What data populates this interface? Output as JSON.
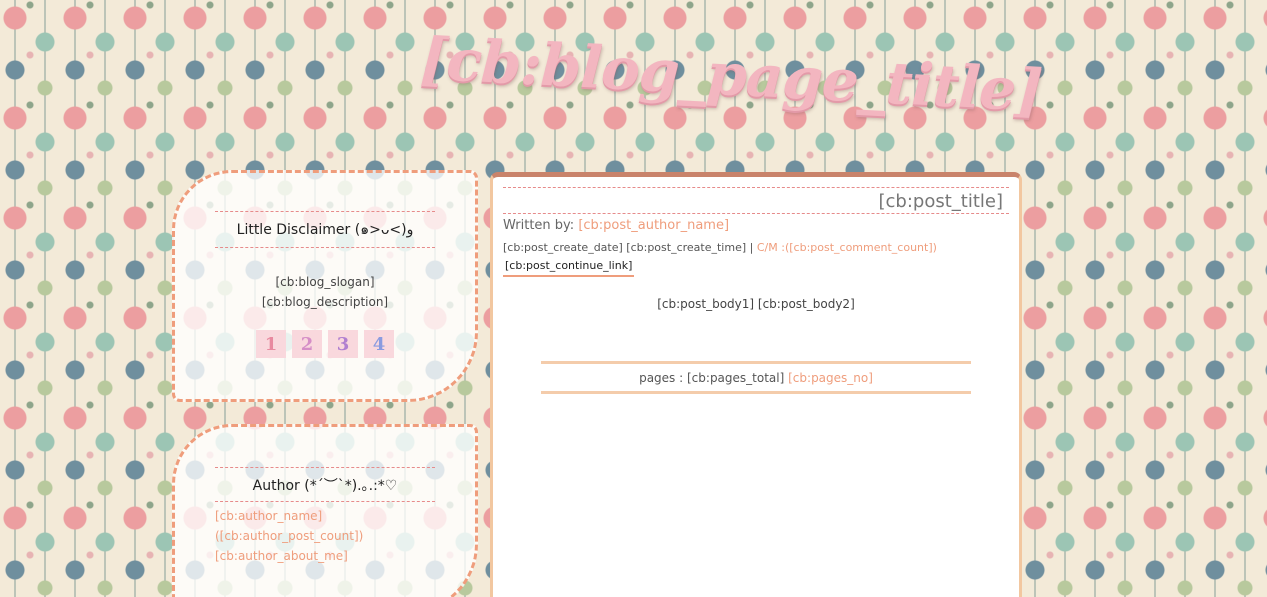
{
  "header": {
    "title": "[cb:blog_page_title]"
  },
  "sidebar": {
    "disclaimer": {
      "heading": "Little Disclaimer (๑>ᴗ<)و",
      "slogan": "[cb:blog_slogan]",
      "description": "[cb:blog_description]",
      "pages": [
        "1",
        "2",
        "3",
        "4"
      ]
    },
    "author": {
      "heading": "Author (*ˊ︶ˋ*).｡.:*♡",
      "name": "[cb:author_name]",
      "post_count": "([cb:author_post_count])",
      "about": "[cb:author_about_me]"
    }
  },
  "post": {
    "title": "[cb:post_title]",
    "written_by_label": "Written by:",
    "author": "[cb:post_author_name]",
    "create_date": "[cb:post_create_date]",
    "create_time": "[cb:post_create_time]",
    "separator": "|",
    "comment_label": "C/M :([cb:post_comment_count])",
    "continue_link": "[cb:post_continue_link]",
    "body": "[cb:post_body1] [cb:post_body2]"
  },
  "pagination": {
    "label": "pages :",
    "total": "[cb:pages_total]",
    "pages_no": "[cb:pages_no]"
  },
  "colors": {
    "accent": "#ef9d7c",
    "title_pink": "#f3b6c0",
    "border_top": "#c9836b"
  }
}
